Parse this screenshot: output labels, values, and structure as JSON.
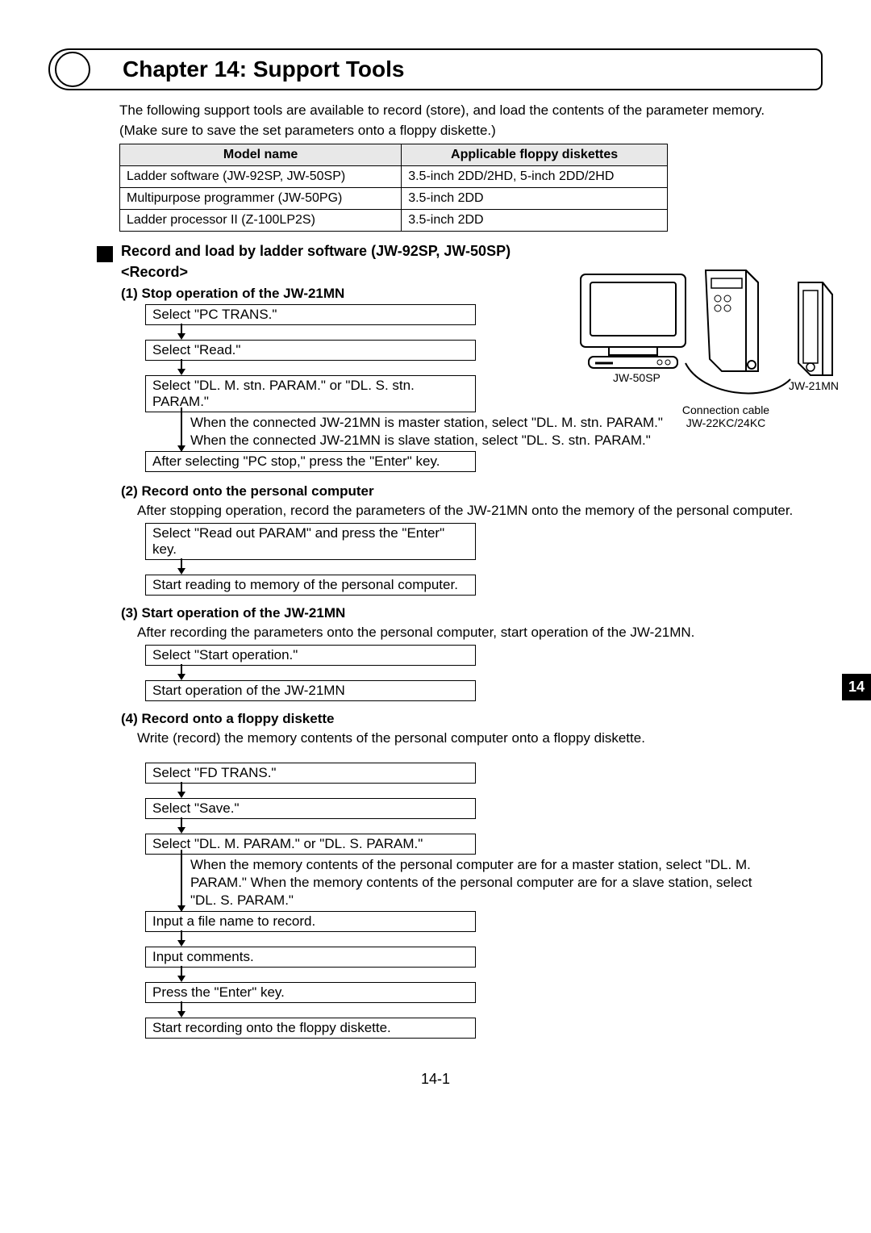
{
  "chapter": {
    "title": "Chapter 14: Support Tools"
  },
  "intro": "The following support tools are available to record (store), and load the contents of the parameter memory.",
  "note": "(Make sure to save the set parameters onto a floppy diskette.)",
  "tools_table": {
    "headers": [
      "Model name",
      "Applicable floppy diskettes"
    ],
    "rows": [
      [
        "Ladder software (JW-92SP, JW-50SP)",
        "3.5-inch 2DD/2HD, 5-inch 2DD/2HD"
      ],
      [
        "Multipurpose programmer (JW-50PG)",
        "3.5-inch 2DD"
      ],
      [
        "Ladder processor II (Z-100LP2S)",
        "3.5-inch 2DD"
      ]
    ]
  },
  "section": {
    "title": "Record and load by ladder software (JW-92SP, JW-50SP)",
    "record_label": "<Record>"
  },
  "step1": {
    "head": "(1) Stop operation of the JW-21MN",
    "b1": "Select \"PC TRANS.\"",
    "b2": "Select \"Read.\"",
    "b3": "Select \"DL. M. stn. PARAM.\" or \"DL. S. stn. PARAM.\"",
    "note": "When the connected JW-21MN is master station, select \"DL. M. stn. PARAM.\" When the connected JW-21MN is slave station, select \"DL. S. stn. PARAM.\"",
    "b4": "After selecting \"PC stop,\" press the  \"Enter\" key."
  },
  "diagram": {
    "jw50sp": "JW-50SP",
    "jw21mn": "JW-21MN",
    "cable1": "Connection cable",
    "cable2": "JW-22KC/24KC"
  },
  "step2": {
    "head": "(2) Record onto the personal computer",
    "text": "After stopping operation, record the parameters of the JW-21MN onto the memory of the personal computer.",
    "b1": "Select \"Read out PARAM\" and press the \"Enter\" key.",
    "b2": "Start reading to memory of the personal computer."
  },
  "step3": {
    "head": "(3) Start operation of the JW-21MN",
    "text": "After recording the parameters onto the personal computer, start operation of the JW-21MN.",
    "b1": "Select \"Start operation.\"",
    "b2": "Start operation of the JW-21MN"
  },
  "step4": {
    "head": "(4) Record onto a floppy diskette",
    "text": "Write (record) the memory contents of the personal computer onto a floppy diskette.",
    "b1": "Select \"FD TRANS.\"",
    "b2": "Select \"Save.\"",
    "b3": "Select \"DL. M. PARAM.\" or \"DL. S. PARAM.\"",
    "note": "When the memory contents of the personal computer are for a master station, select \"DL. M. PARAM.\" When the memory contents of the personal computer are for a slave station, select \"DL. S. PARAM.\"",
    "b4": "Input a file name to record.",
    "b5": "Input comments.",
    "b6": "Press the \"Enter\" key.",
    "b7": "Start recording onto the floppy diskette."
  },
  "page": {
    "tab": "14",
    "num": "14-1"
  }
}
